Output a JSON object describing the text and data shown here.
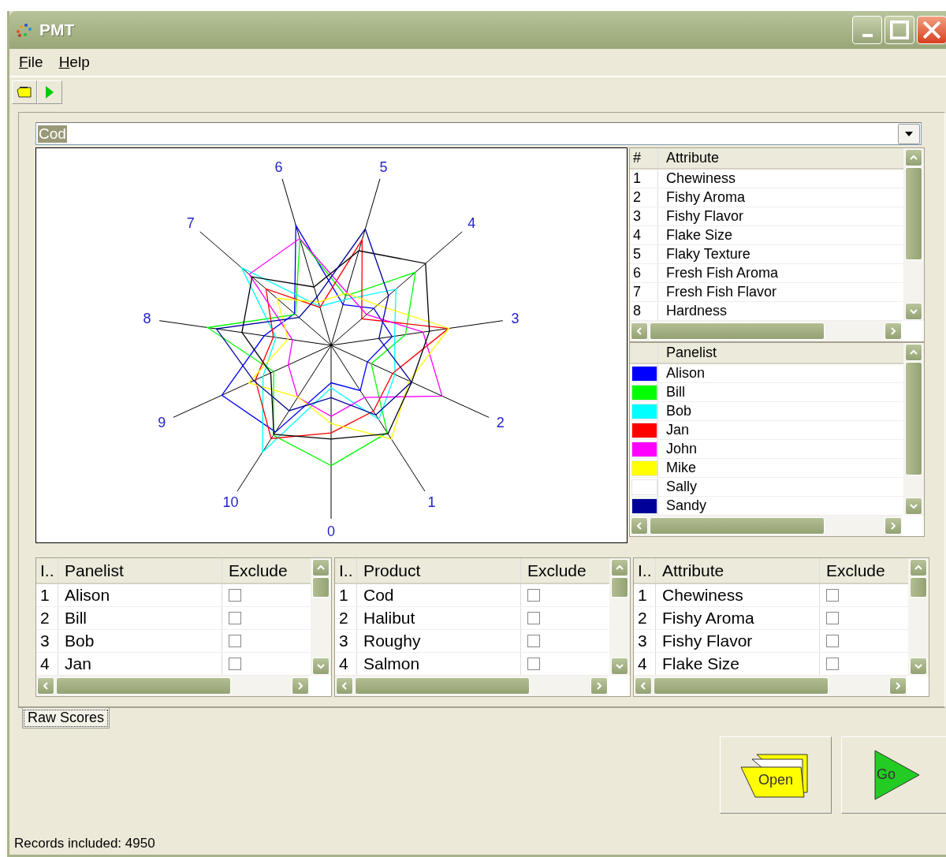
{
  "window": {
    "title": "PMT"
  },
  "menu": [
    {
      "label": "File"
    },
    {
      "label": "Help"
    }
  ],
  "toolbar": [
    {
      "kind": "open"
    },
    {
      "kind": "go"
    }
  ],
  "product_select": {
    "value": "Cod"
  },
  "chart": {
    "axis_labels": [
      "0",
      "1",
      "2",
      "3",
      "4",
      "5",
      "6",
      "7",
      "8",
      "9",
      "10"
    ]
  },
  "attribute_list": {
    "columns": [
      "#",
      "Attribute"
    ],
    "rows": [
      {
        "index": "1",
        "name": "Chewiness"
      },
      {
        "index": "2",
        "name": "Fishy Aroma"
      },
      {
        "index": "3",
        "name": "Fishy Flavor"
      },
      {
        "index": "4",
        "name": "Flake Size"
      },
      {
        "index": "5",
        "name": "Flaky Texture"
      },
      {
        "index": "6",
        "name": "Fresh Fish Aroma"
      },
      {
        "index": "7",
        "name": "Fresh Fish Flavor"
      },
      {
        "index": "8",
        "name": "Hardness"
      }
    ]
  },
  "panelist_legend": {
    "column": "Panelist",
    "items": [
      {
        "name": "Alison",
        "color": "#0000ff"
      },
      {
        "name": "Bill",
        "color": "#00ff00"
      },
      {
        "name": "Bob",
        "color": "#00ffff"
      },
      {
        "name": "Jan",
        "color": "#ff0000"
      },
      {
        "name": "John",
        "color": "#ff00ff"
      },
      {
        "name": "Mike",
        "color": "#ffff00"
      },
      {
        "name": "Sally",
        "color": "#ffffff"
      },
      {
        "name": "Sandy",
        "color": "#000099"
      }
    ]
  },
  "grids": [
    {
      "columns": [
        "I..",
        "Panelist",
        "Exclude"
      ],
      "rows": [
        {
          "index": "1",
          "name": "Alison",
          "checked": false
        },
        {
          "index": "2",
          "name": "Bill",
          "checked": false
        },
        {
          "index": "3",
          "name": "Bob",
          "checked": false
        },
        {
          "index": "4",
          "name": "Jan",
          "checked": false
        }
      ]
    },
    {
      "columns": [
        "I..",
        "Product",
        "Exclude"
      ],
      "rows": [
        {
          "index": "1",
          "name": "Cod",
          "checked": false
        },
        {
          "index": "2",
          "name": "Halibut",
          "checked": false
        },
        {
          "index": "3",
          "name": "Roughy",
          "checked": false
        },
        {
          "index": "4",
          "name": "Salmon",
          "checked": false
        }
      ]
    },
    {
      "columns": [
        "I..",
        "Attribute",
        "Exclude"
      ],
      "rows": [
        {
          "index": "1",
          "name": "Chewiness",
          "checked": false
        },
        {
          "index": "2",
          "name": "Fishy Aroma",
          "checked": false
        },
        {
          "index": "3",
          "name": "Fishy Flavor",
          "checked": false
        },
        {
          "index": "4",
          "name": "Flake Size",
          "checked": false
        }
      ]
    }
  ],
  "tabs": [
    {
      "label": "Raw Scores",
      "selected": true
    }
  ],
  "actions": [
    {
      "kind": "open",
      "label": "Open"
    },
    {
      "kind": "go",
      "label": "Go"
    }
  ],
  "status_bar": {
    "text": "Records included: 4950"
  }
}
